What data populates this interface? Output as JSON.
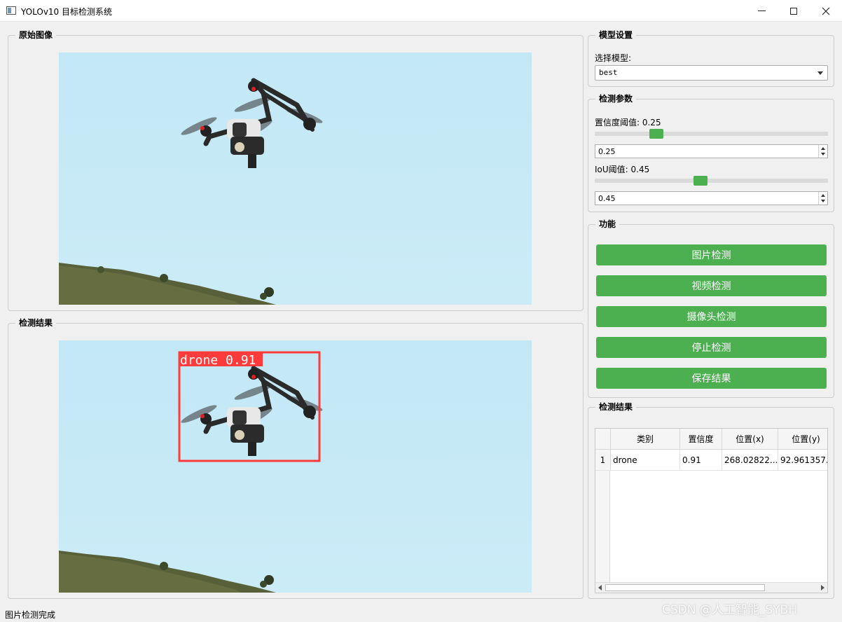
{
  "window": {
    "title": "YOLOv10 目标检测系统",
    "minimize_glyph": "—",
    "maximize_glyph": "□",
    "close_glyph": "✕"
  },
  "original_panel": {
    "title": "原始图像"
  },
  "result_panel": {
    "title": "检测结果",
    "detection_label": "drone 0.91",
    "box_color": "#ff3b3b"
  },
  "model_settings": {
    "title": "模型设置",
    "select_label": "选择模型:",
    "selected_model": "best"
  },
  "detect_params": {
    "title": "检测参数",
    "conf_label": "置信度阈值: 0.25",
    "conf_value": "0.25",
    "conf_slider_level": 0.25,
    "iou_label": "IoU阈值: 0.45",
    "iou_value": "0.45",
    "iou_slider_level": 0.45
  },
  "functions": {
    "title": "功能",
    "accent_color": "#4caf50",
    "buttons": [
      "图片检测",
      "视频检测",
      "摄像头检测",
      "停止检测",
      "保存结果"
    ]
  },
  "results_table": {
    "title": "检测结果",
    "headers": [
      "类别",
      "置信度",
      "位置(x)",
      "位置(y)"
    ],
    "rows": [
      {
        "index": "1",
        "class": "drone",
        "confidence": "0.91",
        "x": "268.02822...",
        "y": "92.961357..."
      }
    ]
  },
  "status_bar": {
    "message": "图片检测完成"
  },
  "watermark": "CSDN @人工智能_SYBH"
}
